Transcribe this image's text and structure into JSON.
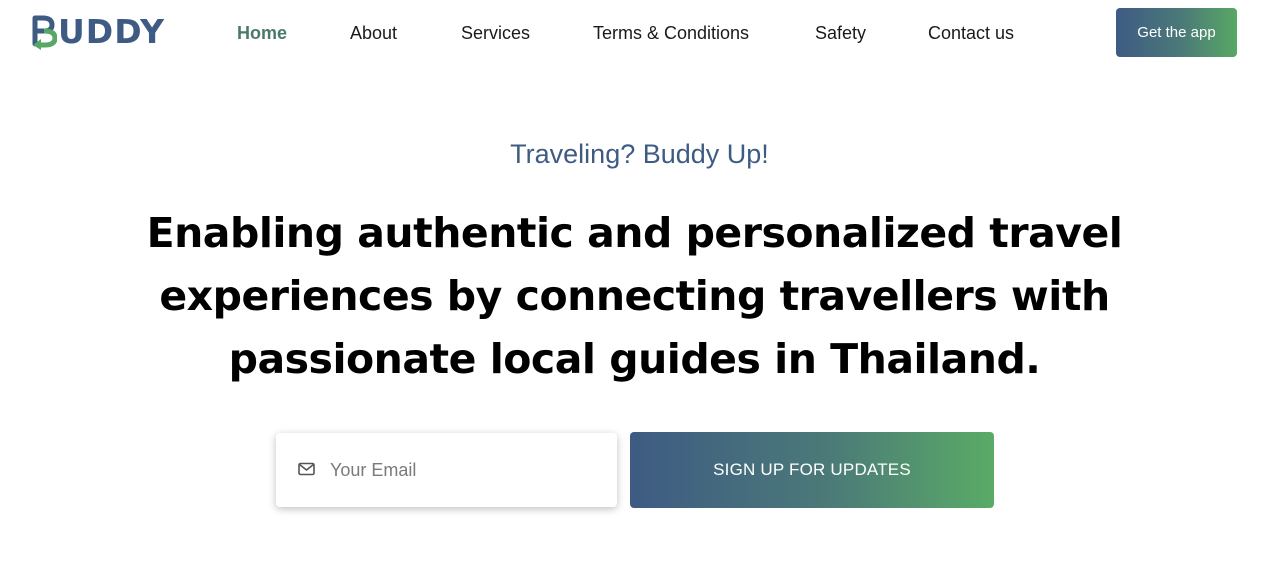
{
  "brand": {
    "name": "UDDY",
    "logo_icon": "buddy-b-arrow-logo",
    "colors": {
      "primary": "#3e5c83",
      "accent": "#58a865"
    }
  },
  "nav": {
    "items": [
      {
        "label": "Home",
        "active": true
      },
      {
        "label": "About"
      },
      {
        "label": "Services"
      },
      {
        "label": "Terms & Conditions"
      },
      {
        "label": "Safety"
      },
      {
        "label": "Contact us"
      }
    ],
    "cta_label": "Get the app"
  },
  "hero": {
    "tagline": "Traveling? Buddy Up!",
    "headline_lines": [
      "Enabling authentic and personalized travel",
      "experiences by connecting travellers with",
      "passionate local guides in Thailand."
    ]
  },
  "signup": {
    "email_placeholder": "Your Email",
    "email_value": "",
    "email_icon": "mail-icon",
    "button_label": "SIGN UP FOR UPDATES"
  }
}
